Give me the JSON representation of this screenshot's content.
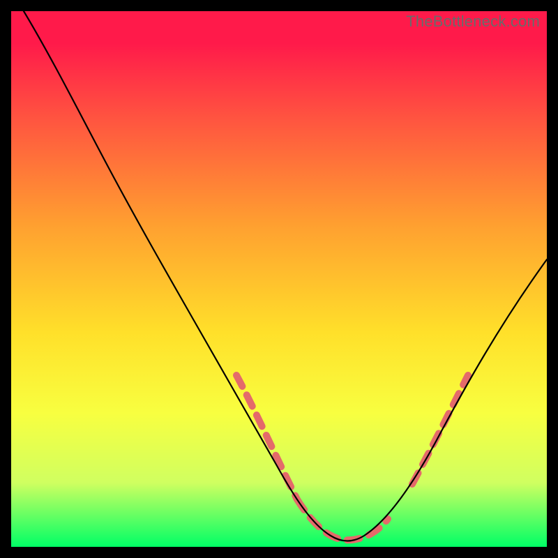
{
  "watermark": "TheBottleneck.com",
  "colors": {
    "frame": "#000000",
    "curve": "#000000",
    "highlight": "#e46a6a",
    "gradient_top": "#ff1a4a",
    "gradient_bottom": "#00ff66"
  },
  "chart_data": {
    "type": "line",
    "title": "",
    "xlabel": "",
    "ylabel": "",
    "xlim": [
      0,
      100
    ],
    "ylim": [
      0,
      100
    ],
    "grid": false,
    "legend": false,
    "series": [
      {
        "name": "bottleneck-curve",
        "x": [
          0,
          6,
          12,
          18,
          24,
          30,
          36,
          42,
          48,
          52,
          56,
          60,
          64,
          68,
          72,
          76,
          80,
          84,
          88,
          92,
          96,
          100
        ],
        "values": [
          100,
          92,
          82,
          72,
          62,
          52,
          42,
          32,
          19,
          12,
          6,
          2,
          1,
          2,
          4,
          9,
          16,
          24,
          32,
          40,
          47,
          54
        ]
      }
    ],
    "annotations": [
      {
        "name": "highlight-left",
        "type": "dashed-segment",
        "x_range": [
          42,
          55
        ],
        "note": "salmon dashed overlay on descending limb near floor"
      },
      {
        "name": "highlight-floor",
        "type": "dashed-segment",
        "x_range": [
          55,
          70
        ],
        "note": "salmon dashed overlay across minimum"
      },
      {
        "name": "highlight-right",
        "type": "dashed-segment",
        "x_range": [
          75,
          85
        ],
        "note": "salmon dashed overlay on ascending limb"
      }
    ]
  }
}
